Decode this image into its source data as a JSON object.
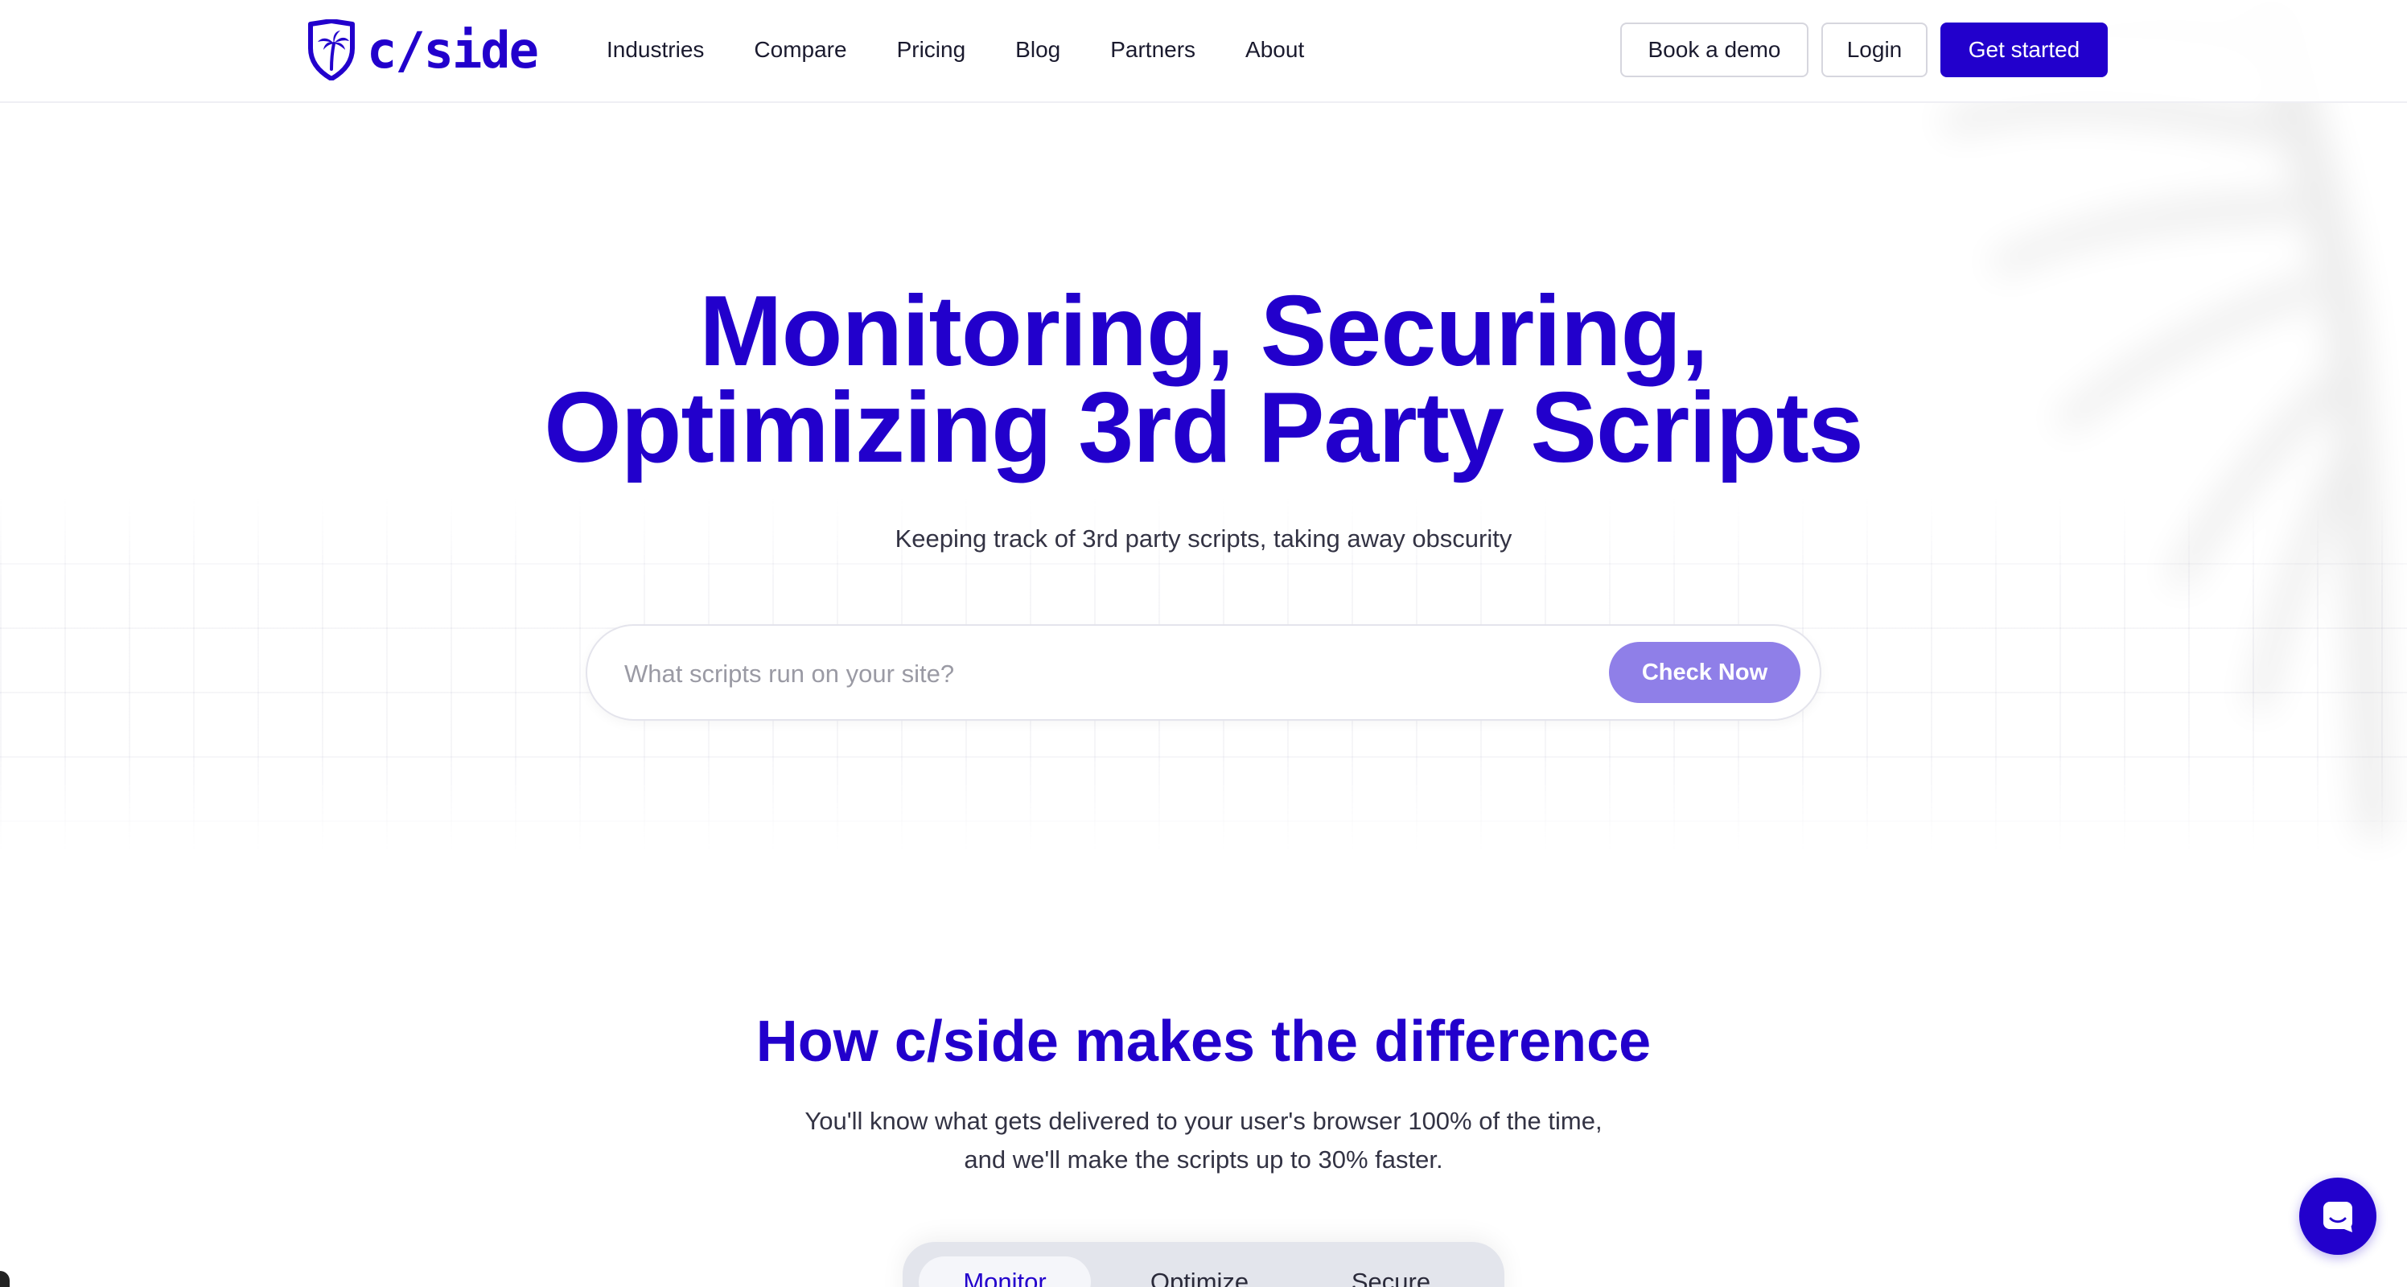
{
  "brand": {
    "name": "c/side",
    "accent": "#2200cc",
    "button_light": "#8f7fe8"
  },
  "nav": {
    "items": [
      {
        "label": "Industries"
      },
      {
        "label": "Compare"
      },
      {
        "label": "Pricing"
      },
      {
        "label": "Blog"
      },
      {
        "label": "Partners"
      },
      {
        "label": "About"
      }
    ]
  },
  "header_actions": {
    "book_demo": "Book a demo",
    "login": "Login",
    "get_started": "Get started"
  },
  "hero": {
    "title_line1": "Monitoring, Securing,",
    "title_line2": "Optimizing 3rd Party Scripts",
    "subtitle": "Keeping track of 3rd party scripts, taking away obscurity",
    "search_placeholder": "What scripts run on your site?",
    "search_value": "",
    "check_button": "Check Now"
  },
  "difference": {
    "title": "How c/side makes the difference",
    "line1": "You'll know what gets delivered to your user's browser 100% of the time,",
    "line2": "and we'll make the scripts up to 30% faster."
  },
  "tabs": [
    {
      "label": "Monitor",
      "active": true
    },
    {
      "label": "Optimize",
      "active": false
    },
    {
      "label": "Secure",
      "active": false
    }
  ],
  "icons": {
    "logo": "shield-palm-icon",
    "chat": "chat-bubble-icon"
  }
}
